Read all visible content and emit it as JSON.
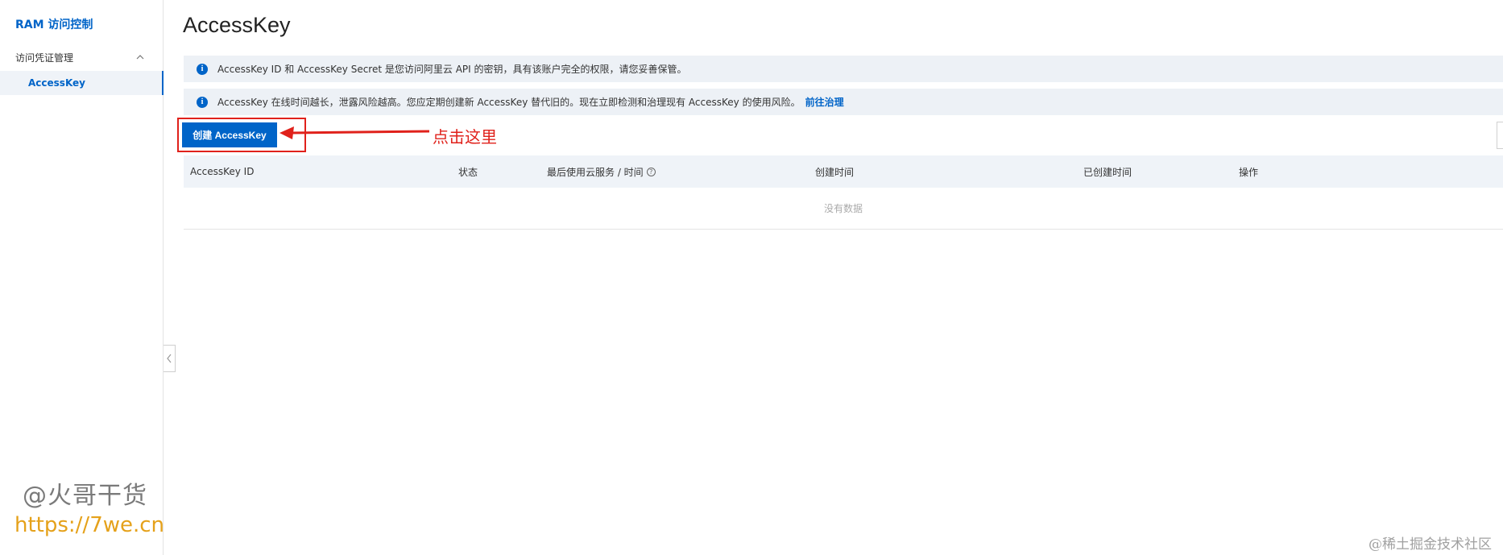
{
  "sidebar": {
    "brand": "RAM 访问控制",
    "group_label": "访问凭证管理",
    "active_item": "AccessKey"
  },
  "watermark": {
    "name": "@火哥干货",
    "url": "https://7we.cn",
    "footer": "@稀土掘金技术社区"
  },
  "main": {
    "title": "AccessKey",
    "notices": [
      {
        "text": "AccessKey ID 和 AccessKey Secret 是您访问阿里云 API 的密钥，具有该账户完全的权限，请您妥善保管。"
      },
      {
        "text": "AccessKey 在线时间越长，泄露风险越高。您应定期创建新 AccessKey 替代旧的。现在立即检测和治理现有 AccessKey 的使用风险。",
        "link": "前往治理"
      }
    ],
    "create_button": "创建 AccessKey",
    "annotation": "点击这里",
    "table": {
      "columns": [
        "AccessKey ID",
        "状态",
        "最后使用云服务 / 时间",
        "创建时间",
        "已创建时间",
        "操作"
      ],
      "empty_text": "没有数据"
    }
  },
  "colors": {
    "accent": "#0064c8",
    "annotation_red": "#e0211b",
    "notice_bg": "#edf1f6"
  }
}
